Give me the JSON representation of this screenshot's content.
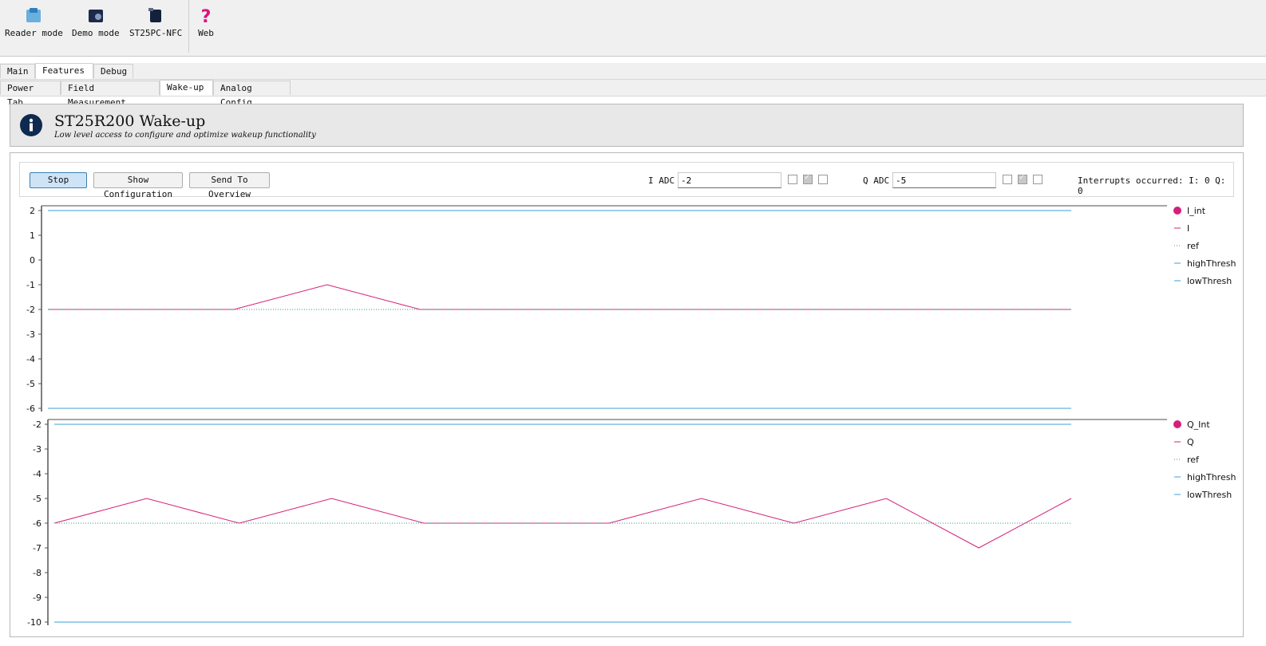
{
  "toolbar": {
    "items": [
      {
        "label": "Reader mode",
        "icon": "reader-icon"
      },
      {
        "label": "Demo mode",
        "icon": "demo-icon"
      },
      {
        "label": "ST25PC-NFC",
        "icon": "chip-icon"
      },
      {
        "label": "Web",
        "icon": "help-icon"
      }
    ]
  },
  "tabs_main": [
    "Main",
    "Features",
    "Debug"
  ],
  "tabs_sub": [
    "Power Tab",
    "Field Measurement",
    "Wake-up",
    "Analog Config"
  ],
  "banner": {
    "title": "ST25R200 Wake-up",
    "subtitle": "Low level access to configure and optimize wakeup functionality"
  },
  "controls": {
    "stop_label": "Stop",
    "show_config_label": "Show Configuration",
    "send_overview_label": "Send To Overview",
    "i_adc_label": "I ADC",
    "i_adc_value": "-2",
    "q_adc_label": "Q ADC",
    "q_adc_value": "-5",
    "i_checks": [
      false,
      true,
      false
    ],
    "q_checks": [
      false,
      true,
      false
    ],
    "interrupts_text": "Interrupts occurred: I: 0 Q: 0"
  },
  "colors": {
    "signal": "#d4207a",
    "ref": "#2a9d8f",
    "thresh": "#3aa0d8"
  },
  "chart_data": [
    {
      "type": "line",
      "ylim": [
        -6,
        2
      ],
      "yticks": [
        "2",
        "1",
        "0",
        "-1",
        "-2",
        "-3",
        "-4",
        "-5",
        "-6"
      ],
      "legend": [
        "I_int",
        "I",
        "ref",
        "highThresh",
        "lowThresh"
      ],
      "series": [
        {
          "name": "I",
          "x": [
            0,
            1,
            2,
            3,
            4,
            5,
            6,
            7,
            8,
            9,
            10,
            11
          ],
          "values": [
            -2,
            -2,
            -2,
            -1,
            -2,
            -2,
            -2,
            -2,
            -2,
            -2,
            -2,
            -2
          ]
        },
        {
          "name": "ref",
          "x": [
            0,
            11
          ],
          "values": [
            -2,
            -2
          ]
        },
        {
          "name": "highThresh",
          "x": [
            0,
            11
          ],
          "values": [
            2,
            2
          ]
        },
        {
          "name": "lowThresh",
          "x": [
            0,
            11
          ],
          "values": [
            -6,
            -6
          ]
        }
      ]
    },
    {
      "type": "line",
      "ylim": [
        -10,
        -2
      ],
      "yticks": [
        "-2",
        "-3",
        "-4",
        "-5",
        "-6",
        "-7",
        "-8",
        "-9",
        "-10"
      ],
      "legend": [
        "Q_Int",
        "Q",
        "ref",
        "highThresh",
        "lowThresh"
      ],
      "series": [
        {
          "name": "Q",
          "x": [
            0,
            1,
            2,
            3,
            4,
            5,
            6,
            7,
            8,
            9,
            10,
            11
          ],
          "values": [
            -6,
            -5,
            -6,
            -5,
            -6,
            -6,
            -6,
            -5,
            -6,
            -5,
            -7,
            -5
          ]
        },
        {
          "name": "ref",
          "x": [
            0,
            11
          ],
          "values": [
            -6,
            -6
          ]
        },
        {
          "name": "highThresh",
          "x": [
            0,
            11
          ],
          "values": [
            -2,
            -2
          ]
        },
        {
          "name": "lowThresh",
          "x": [
            0,
            11
          ],
          "values": [
            -10,
            -10
          ]
        }
      ]
    }
  ]
}
